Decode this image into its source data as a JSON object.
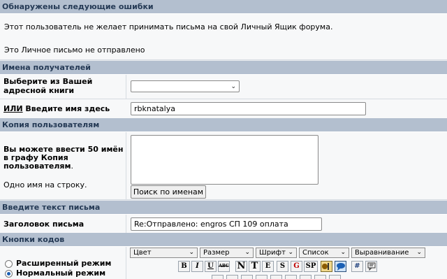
{
  "errors": {
    "header": "Обнаружены следующие ошибки",
    "messages": [
      "Этот пользователь не желает принимать письма на свой Личный Ящик форума.",
      "Это Личное письмо не отправлено"
    ]
  },
  "recipients": {
    "header": "Имена получателей",
    "addressbook_label": "Выберите из Вашей адресной книги",
    "addressbook_value": "",
    "or_label": "ИЛИ",
    "name_label": " Введите имя здесь",
    "name_value": "rbknatalya"
  },
  "cc": {
    "header": "Копия пользователям",
    "info_bold": "Вы можете ввести 50 имён в графу Копия пользователям",
    "info_period": ".",
    "per_line": "Одно имя на строку.",
    "textarea_value": "",
    "search_button": "Поиск по именам"
  },
  "message": {
    "header": "Введите текст письма",
    "subject_label": "Заголовок письма",
    "subject_value": "Re:Отправлено:  engros СП 109 оплата"
  },
  "codes": {
    "header": "Кнопки кодов",
    "mode_extended": "Расширенный режим",
    "mode_normal": "Нормальный режим",
    "selected_mode": "normal",
    "dropdowns": [
      "Цвет",
      "Размер",
      "Шрифт",
      "Список",
      "Выравнивание"
    ],
    "toolbar_buttons": [
      "B",
      "I",
      "U",
      "ABC",
      "N",
      "T",
      "E",
      "S",
      "G",
      "SP",
      "",
      "",
      "#",
      ""
    ]
  }
}
